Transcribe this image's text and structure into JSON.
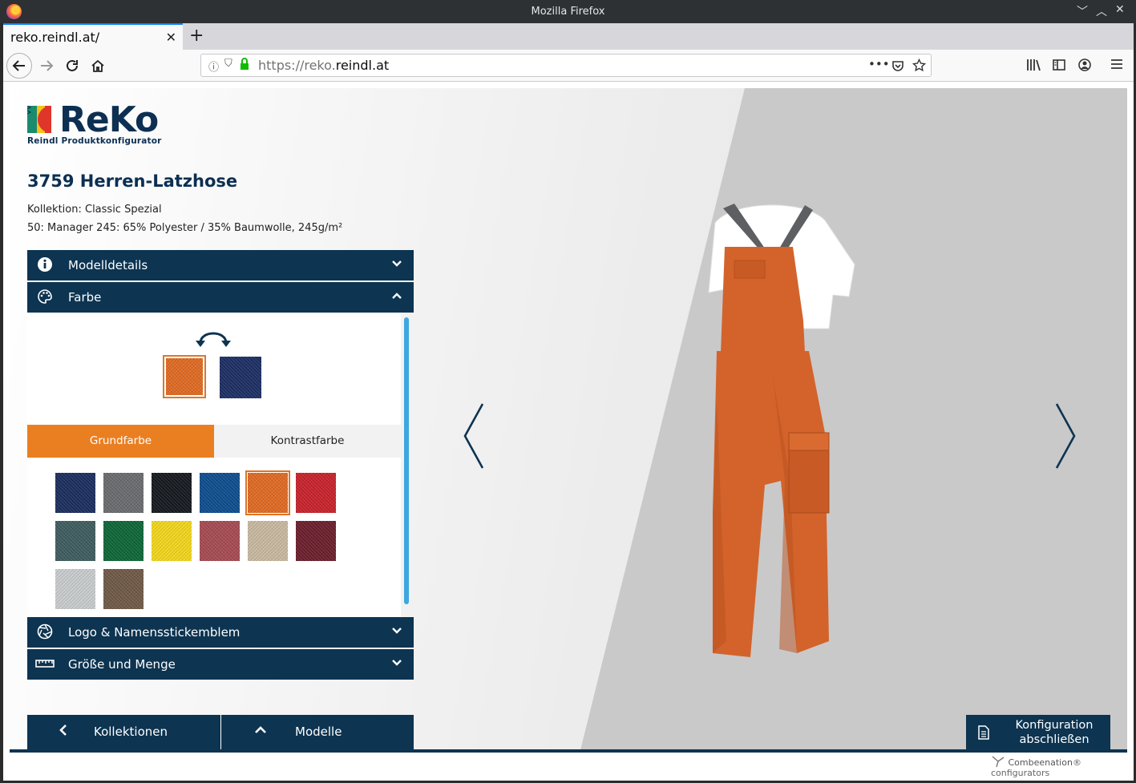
{
  "window": {
    "title": "Mozilla Firefox",
    "controls": [
      "﹀",
      "︿",
      "✕"
    ]
  },
  "browser": {
    "tab_title": "reko.reindl.at/",
    "tab_close": "✕",
    "new_tab": "+",
    "url_prefix": "https://reko.",
    "url_domain": "reindl.at",
    "url_more": "•••"
  },
  "logo": {
    "wordmark": "ReKo",
    "subtitle": "Reindl Produktkonfigurator"
  },
  "product": {
    "title": "3759 Herren-Latzhose",
    "collection": "Kollektion: Classic Spezial",
    "fabric": "50: Manager 245: 65% Polyester / 35% Baumwolle, 245g/m²"
  },
  "accordion": {
    "modelldetails": "Modelldetails",
    "farbe": "Farbe",
    "logo": "Logo & Namensstickemblem",
    "groesse": "Größe und Menge"
  },
  "farbe": {
    "selected_primary": "#e06a22",
    "selected_contrast": "#1c2e63",
    "tab_grundfarbe": "Grundfarbe",
    "tab_kontrastfarbe": "Kontrastfarbe",
    "swatches": [
      {
        "color": "#1b2d5e"
      },
      {
        "color": "#6a6b6e"
      },
      {
        "color": "#15191f"
      },
      {
        "color": "#0e4d8e"
      },
      {
        "color": "#e06a22"
      },
      {
        "color": "#c8222b"
      },
      {
        "color": "#3e5c5e"
      },
      {
        "color": "#0e6637"
      },
      {
        "color": "#f2d61c"
      },
      {
        "color": "#a64a52"
      },
      {
        "color": "#c8b9a0"
      },
      {
        "color": "#6b1e2c"
      },
      {
        "color": "#c9ccce"
      },
      {
        "color": "#6f5946"
      }
    ],
    "selected_index": 4
  },
  "bottom": {
    "kollektionen": "Kollektionen",
    "modelle": "Modelle",
    "finish_line1": "Konfiguration",
    "finish_line2": "abschließen"
  },
  "footer": {
    "brand": "Combeenation",
    "suffix": "® configurators"
  },
  "colors": {
    "navy": "#0d3451",
    "orange": "#ea7f22",
    "scroll": "#3ea7e0"
  }
}
